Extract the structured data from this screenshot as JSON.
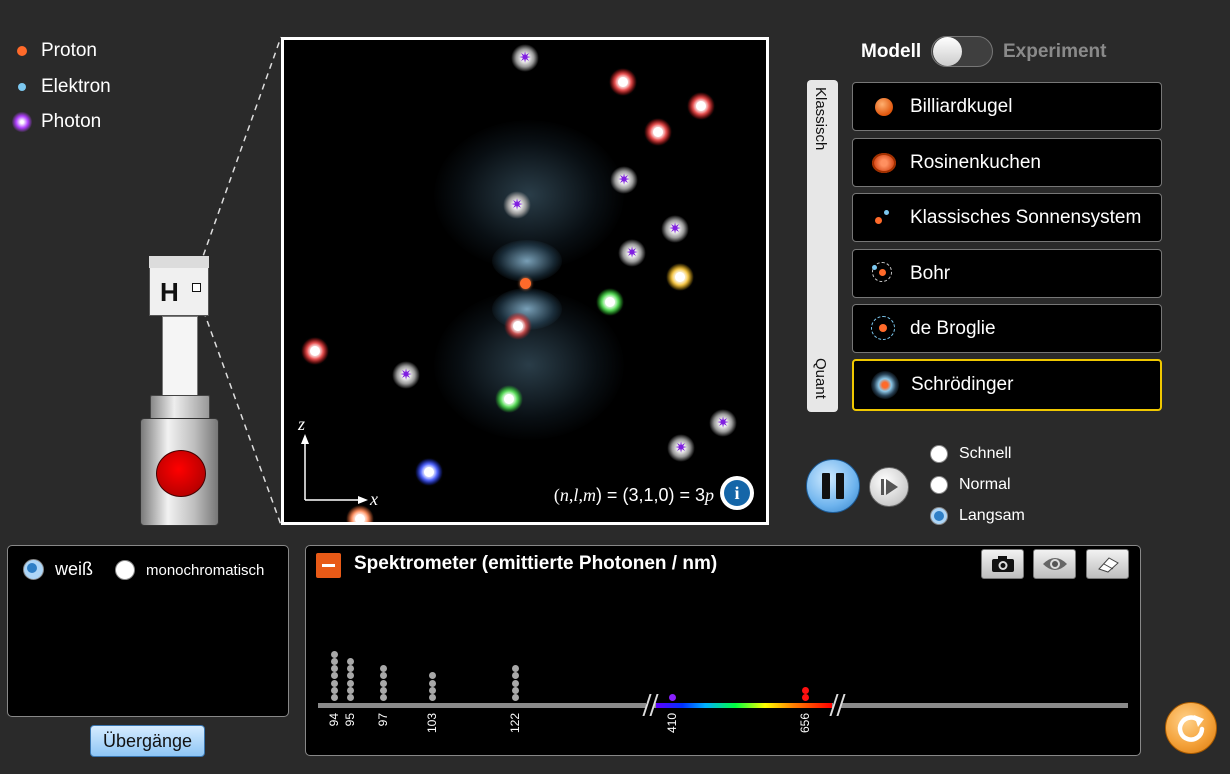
{
  "legend": {
    "items": [
      {
        "label": "Proton",
        "icon": "proton-icon"
      },
      {
        "label": "Elektron",
        "icon": "electron-icon"
      },
      {
        "label": "Photon",
        "icon": "photon-icon"
      }
    ]
  },
  "gun": {
    "label": "H"
  },
  "view": {
    "axis_z": "z",
    "axis_x": "x",
    "quantum_numbers": "(n,l,m) = (3,1,0) = 3p",
    "qn_prefix": "(",
    "qn_n": "n",
    "qn_sep1": ",",
    "qn_l": "l",
    "qn_sep2": ",",
    "qn_m": "m",
    "qn_mid": ") = (3,1,0) = 3",
    "qn_p": "p",
    "info_label": "i"
  },
  "mode_toggle": {
    "left_label": "Modell",
    "right_label": "Experiment",
    "selected": "Modell"
  },
  "model_scale": {
    "top_label": "Klassisch",
    "bottom_label": "Quant"
  },
  "models": [
    {
      "label": "Billiardkugel",
      "selected": false
    },
    {
      "label": "Rosinenkuchen",
      "selected": false
    },
    {
      "label": "Klassisches Sonnensystem",
      "selected": false
    },
    {
      "label": "Bohr",
      "selected": false
    },
    {
      "label": "de Broglie",
      "selected": false
    },
    {
      "label": "Schrödinger",
      "selected": true
    }
  ],
  "speed": {
    "options": [
      "Schnell",
      "Normal",
      "Langsam"
    ],
    "selected": "Langsam"
  },
  "light": {
    "options": [
      "weiß",
      "monochromatisch"
    ],
    "selected": "weiß"
  },
  "transitions_button": "Übergänge",
  "spectrometer": {
    "title": "Spektrometer (emittierte Photonen / nm)",
    "tools": [
      "camera-icon",
      "eye-icon",
      "eraser-icon"
    ],
    "ticks": [
      "94",
      "95",
      "97",
      "103",
      "122",
      "410",
      "656"
    ],
    "counts": [
      7,
      6,
      5,
      4,
      5,
      1,
      2
    ]
  },
  "colors": {
    "selected_border": "#f0c800",
    "proton": "#ff6a2a",
    "electron": "#7cc8f0",
    "photon": "#a020ff",
    "accent_blue": "#2f7fc6",
    "reset_orange": "#f4a23a"
  }
}
